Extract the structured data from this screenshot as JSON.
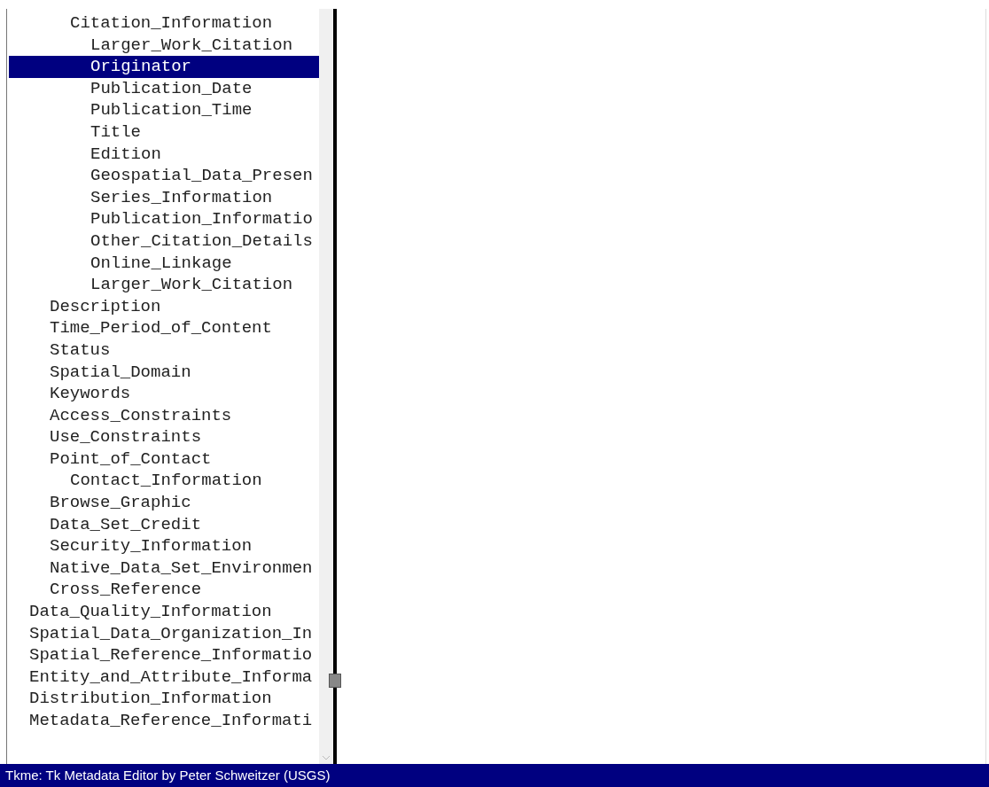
{
  "tree": [
    {
      "children": [
        {
          "children": [
            {
              "label": "Citation_Information",
              "selected": false,
              "children": [
                {
                  "label": "Larger_Work_Citation",
                  "selected": false
                },
                {
                  "label": "Originator",
                  "selected": true
                },
                {
                  "label": "Publication_Date",
                  "selected": false
                },
                {
                  "label": "Publication_Time",
                  "selected": false
                },
                {
                  "label": "Title",
                  "selected": false
                },
                {
                  "label": "Edition",
                  "selected": false
                },
                {
                  "label": "Geospatial_Data_Presen",
                  "selected": false
                },
                {
                  "label": "Series_Information",
                  "selected": false
                },
                {
                  "label": "Publication_Informatio",
                  "selected": false
                },
                {
                  "label": "Other_Citation_Details",
                  "selected": false
                },
                {
                  "label": "Online_Linkage",
                  "selected": false
                },
                {
                  "label": "Larger_Work_Citation",
                  "selected": false
                }
              ]
            }
          ]
        },
        {
          "label": "Description",
          "selected": false
        },
        {
          "label": "Time_Period_of_Content",
          "selected": false
        },
        {
          "label": "Status",
          "selected": false
        },
        {
          "label": "Spatial_Domain",
          "selected": false
        },
        {
          "label": "Keywords",
          "selected": false
        },
        {
          "label": "Access_Constraints",
          "selected": false
        },
        {
          "label": "Use_Constraints",
          "selected": false
        },
        {
          "label": "Point_of_Contact",
          "selected": false,
          "children": [
            {
              "label": "Contact_Information",
              "selected": false
            }
          ]
        },
        {
          "label": "Browse_Graphic",
          "selected": false
        },
        {
          "label": "Data_Set_Credit",
          "selected": false
        },
        {
          "label": "Security_Information",
          "selected": false
        },
        {
          "label": "Native_Data_Set_Environmen",
          "selected": false
        },
        {
          "label": "Cross_Reference",
          "selected": false
        }
      ]
    },
    {
      "label": "Data_Quality_Information",
      "selected": false
    },
    {
      "label": "Spatial_Data_Organization_In",
      "selected": false
    },
    {
      "label": "Spatial_Reference_Informatio",
      "selected": false
    },
    {
      "label": "Entity_and_Attribute_Informa",
      "selected": false
    },
    {
      "label": "Distribution_Information",
      "selected": false
    },
    {
      "label": "Metadata_Reference_Informati",
      "selected": false
    }
  ],
  "status_bar": "Tkme: Tk Metadata Editor by Peter Schweitzer (USGS)"
}
